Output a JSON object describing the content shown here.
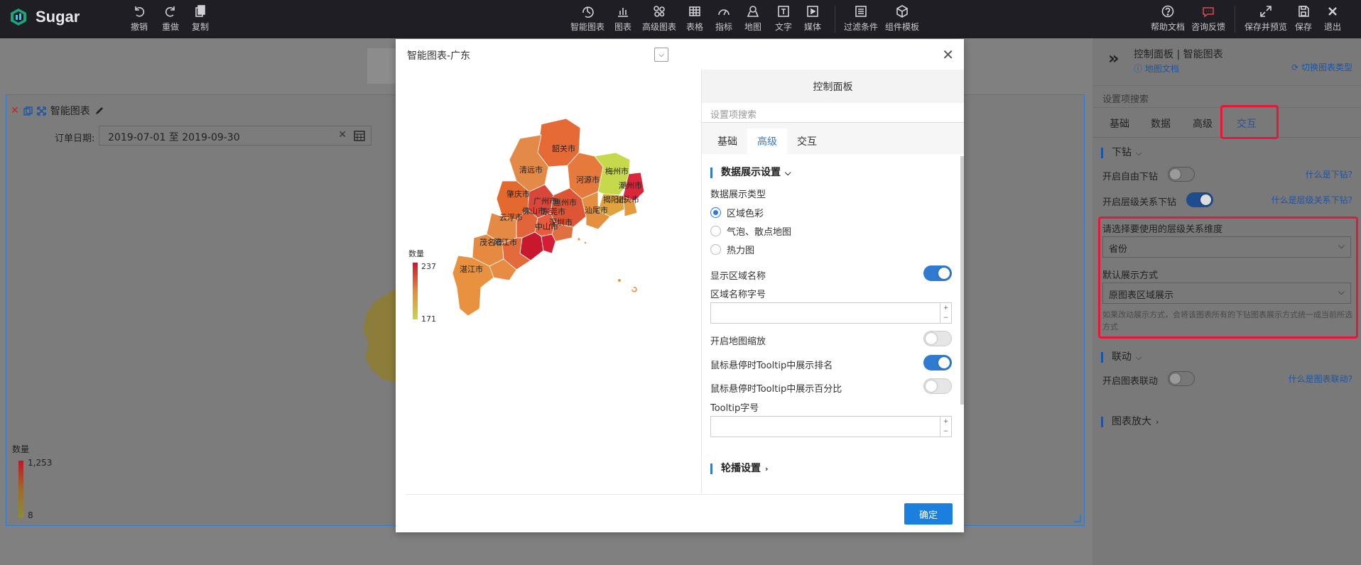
{
  "app": {
    "name": "Sugar"
  },
  "toolbar": {
    "left": [
      {
        "label": "撤销",
        "icon": "undo-icon"
      },
      {
        "label": "重做",
        "icon": "redo-icon"
      },
      {
        "label": "复制",
        "icon": "copy-icon"
      }
    ],
    "center": [
      {
        "label": "智能图表",
        "icon": "smart-chart-icon"
      },
      {
        "label": "图表",
        "icon": "bar-chart-icon"
      },
      {
        "label": "高级图表",
        "icon": "advanced-chart-icon"
      },
      {
        "label": "表格",
        "icon": "table-icon"
      },
      {
        "label": "指标",
        "icon": "gauge-icon"
      },
      {
        "label": "地图",
        "icon": "map-pin-icon"
      },
      {
        "label": "文字",
        "icon": "text-icon"
      },
      {
        "label": "媒体",
        "icon": "media-icon"
      },
      {
        "label": "过滤条件",
        "icon": "filter-icon"
      },
      {
        "label": "组件模板",
        "icon": "template-icon"
      }
    ],
    "right": [
      {
        "label": "帮助文档",
        "icon": "help-icon"
      },
      {
        "label": "咨询反馈",
        "icon": "feedback-icon"
      },
      {
        "label": "保存并预览",
        "icon": "expand-icon"
      },
      {
        "label": "保存",
        "icon": "save-icon"
      },
      {
        "label": "退出",
        "icon": "close-icon"
      }
    ]
  },
  "panel": {
    "title": "智能图表",
    "date_label": "订单日期:",
    "date_value": "2019-07-01 至 2019-09-30",
    "legend_title": "数量",
    "legend_max": "1,253",
    "legend_min": "8"
  },
  "dialog": {
    "title": "智能图表-广东",
    "confirm": "确定",
    "map": {
      "legend_title": "数量",
      "legend_max": "237",
      "legend_min": "171",
      "regions": [
        "韶关市",
        "清远市",
        "河源市",
        "梅州市",
        "潮州市",
        "肇庆市",
        "广州市",
        "惠州市",
        "揭阳市",
        "汕头市",
        "云浮市",
        "佛山市",
        "东莞市",
        "汕尾市",
        "深圳市",
        "中山市",
        "茂名市",
        "阳江市",
        "湛江市"
      ]
    },
    "control": {
      "header": "控制面板",
      "search_placeholder": "设置项搜索",
      "tabs": [
        "基础",
        "高级",
        "交互"
      ],
      "active_tab": "高级",
      "section1": "数据展示设置",
      "display_type_label": "数据展示类型",
      "radios": [
        "区域色彩",
        "气泡、散点地图",
        "热力图"
      ],
      "selected_radio": "区域色彩",
      "show_region_name": "显示区域名称",
      "show_region_name_on": true,
      "region_font_label": "区域名称字号",
      "map_zoom": "开启地图缩放",
      "map_zoom_on": false,
      "tooltip_rank": "鼠标悬停时Tooltip中展示排名",
      "tooltip_rank_on": true,
      "tooltip_percent": "鼠标悬停时Tooltip中展示百分比",
      "tooltip_percent_on": false,
      "tooltip_font_label": "Tooltip字号",
      "section2": "轮播设置"
    }
  },
  "right_panel": {
    "title": "控制面板 | 智能图表",
    "doc_link": "地图文档",
    "switch_type": "切换图表类型",
    "search_placeholder": "设置项搜索",
    "tabs": [
      "基础",
      "数据",
      "高级",
      "交互"
    ],
    "active_tab": "交互",
    "drill_section": "下钻",
    "free_drill": "开启自由下钻",
    "free_drill_on": false,
    "free_drill_help": "什么是下钻?",
    "hier_drill": "开启层级关系下钻",
    "hier_drill_on": true,
    "hier_drill_help": "什么是层级关系下钻?",
    "dim_label": "请选择要使用的层级关系维度",
    "dim_value": "省份",
    "default_mode_label": "默认展示方式",
    "default_mode_value": "原图表区域展示",
    "note": "如果改动展示方式，会将该图表所有的下钻图表展示方式统一成当前所选方式",
    "link_section": "联动",
    "chart_link": "开启图表联动",
    "chart_link_on": false,
    "chart_link_help": "什么是图表联动?",
    "zoom_section": "图表放大"
  },
  "colors": {
    "accent": "#2e7bd1",
    "highlight": "#e8173a",
    "toolbar_bg": "#1e1e24"
  }
}
